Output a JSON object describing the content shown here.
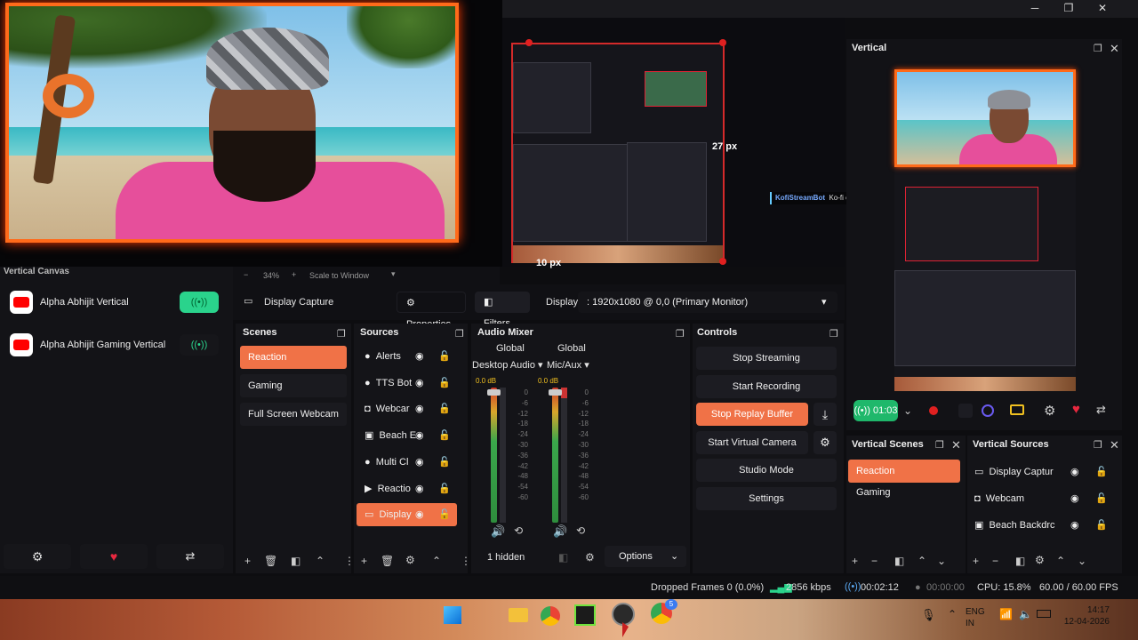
{
  "window": {
    "minimize": "─",
    "restore": "❐",
    "close": "✕"
  },
  "preview": {
    "px_right": "27 px",
    "px_bottom": "10 px",
    "chatbot_name": "KofiStreamBot",
    "chatbot_msg": "Ko-fi chatbot connected! Hello!"
  },
  "vertical": {
    "title": "Vertical",
    "timer": "01:03"
  },
  "vertical_canvas": {
    "title": "Vertical Canvas",
    "zoom": "34%",
    "scale_mode": "Scale to Window",
    "channels": [
      {
        "label": "Alpha Abhijit Vertical",
        "live": true
      },
      {
        "label": "Alpha Abhijit Gaming Vertical",
        "live": false
      }
    ]
  },
  "toolbar": {
    "source_label": "Display Capture",
    "properties": "Properties",
    "filters": "Filters",
    "display_label": "Display",
    "display_value": ": 1920x1080 @ 0,0 (Primary Monitor)"
  },
  "scenes": {
    "title": "Scenes",
    "items": [
      "Reaction",
      "Gaming",
      "Full Screen Webcam"
    ],
    "active": 0
  },
  "sources": {
    "title": "Sources",
    "items": [
      "Alerts",
      "TTS Bot",
      "Webcar",
      "Beach E",
      "Multi Cl",
      "Reactio",
      "Display"
    ],
    "active": 6
  },
  "audio": {
    "title": "Audio Mixer",
    "channels": [
      {
        "group": "Global",
        "name": "Desktop Audio",
        "db": "0.0 dB"
      },
      {
        "group": "Global",
        "name": "Mic/Aux",
        "db": "0.0 dB"
      }
    ],
    "scale": [
      "0",
      "-6",
      "-12",
      "-18",
      "-24",
      "-30",
      "-36",
      "-42",
      "-48",
      "-54",
      "-60"
    ],
    "hidden": "1 hidden",
    "options": "Options"
  },
  "controls": {
    "title": "Controls",
    "buttons": [
      "Stop Streaming",
      "Start Recording",
      "Stop Replay Buffer",
      "Start Virtual Camera",
      "Studio Mode",
      "Settings"
    ]
  },
  "vertical_scenes": {
    "title": "Vertical Scenes",
    "items": [
      "Reaction",
      "Gaming"
    ],
    "active": 0
  },
  "vertical_sources": {
    "title": "Vertical Sources",
    "items": [
      "Display Captur",
      "Webcam",
      "Beach Backdrc"
    ]
  },
  "status": {
    "dropped": "Dropped Frames 0 (0.0%)",
    "kbps": "2856 kbps",
    "stream_time": "00:02:12",
    "rec_time": "00:00:00",
    "cpu": "CPU: 15.8%",
    "fps": "60.00 / 60.00 FPS"
  },
  "taskbar": {
    "lang1": "ENG",
    "lang2": "IN",
    "time": "14:17",
    "date": "12-04-2026",
    "badge": "5"
  },
  "colors": {
    "accent": "#f07247",
    "live": "#2ad38c",
    "frame": "#ff6a1a"
  }
}
